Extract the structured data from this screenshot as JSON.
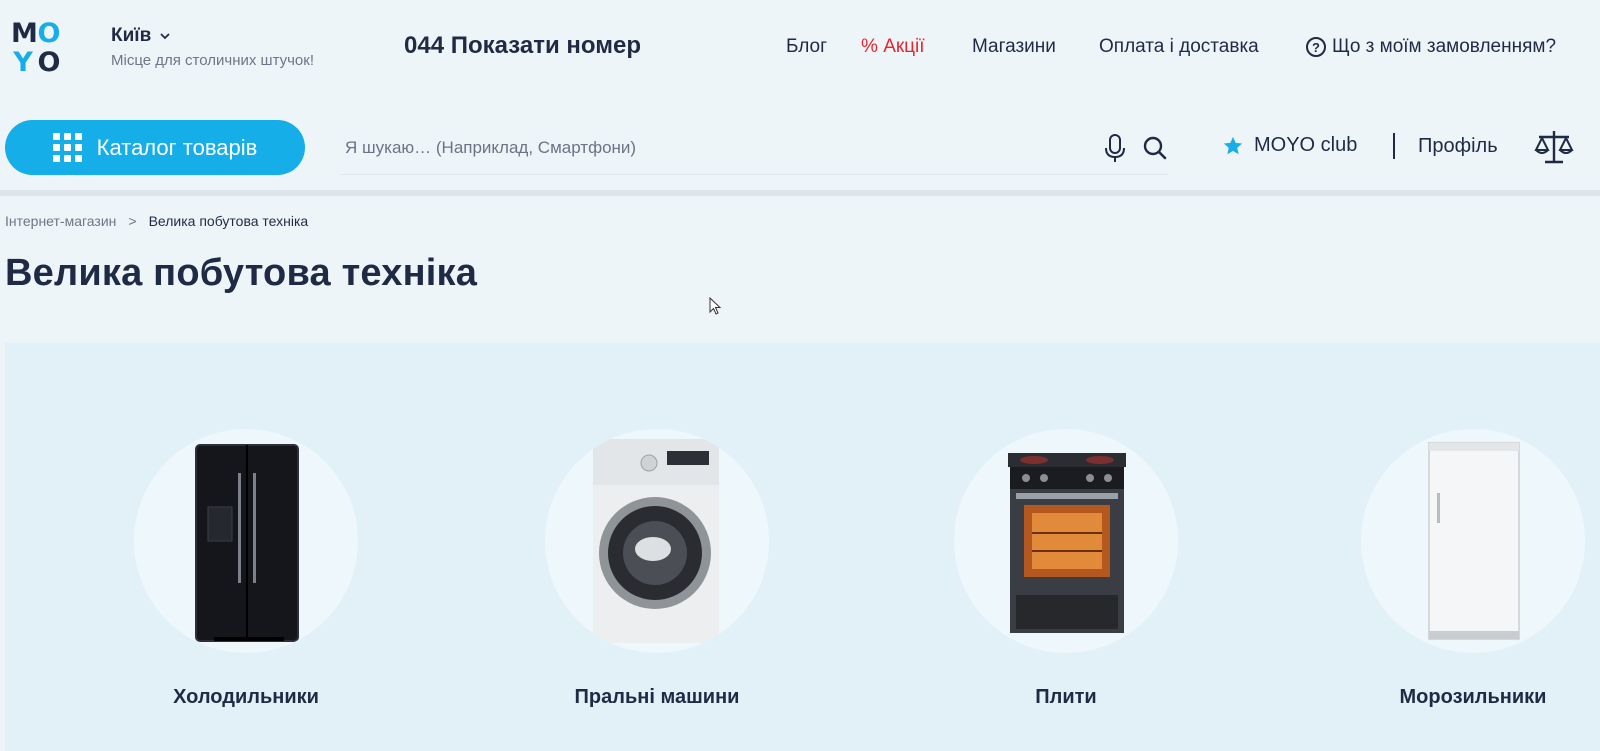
{
  "header": {
    "logo_letters": [
      "M",
      "O",
      "Y",
      "O"
    ],
    "city": "Київ",
    "tagline": "Місце для столичних штучок!",
    "phone": "044 Показати номер",
    "nav": {
      "blog": "Блог",
      "promo": "Акції",
      "promo_symbol": "%",
      "shops": "Магазини",
      "payment": "Оплата і доставка",
      "order": "Що з моїм замовленням?"
    }
  },
  "toolbar": {
    "catalog_label": "Каталог товарів",
    "search_placeholder": "Я шукаю… (Наприклад, Смартфони)",
    "club_label": "MOYO club",
    "profile_label": "Профіль"
  },
  "breadcrumb": {
    "home": "Інтернет-магазин",
    "separator": ">",
    "current": "Велика побутова техніка"
  },
  "page": {
    "title": "Велика побутова техніка"
  },
  "categories": [
    {
      "label": "Холодильники",
      "icon": "refrigerator-image"
    },
    {
      "label": "Пральні машини",
      "icon": "washing-machine-image"
    },
    {
      "label": "Плити",
      "icon": "stove-image"
    },
    {
      "label": "Морозильники",
      "icon": "freezer-image"
    }
  ],
  "colors": {
    "accent": "#15aee8",
    "promo": "#e6252d",
    "text": "#1f2a44",
    "background": "#eef5f9"
  }
}
